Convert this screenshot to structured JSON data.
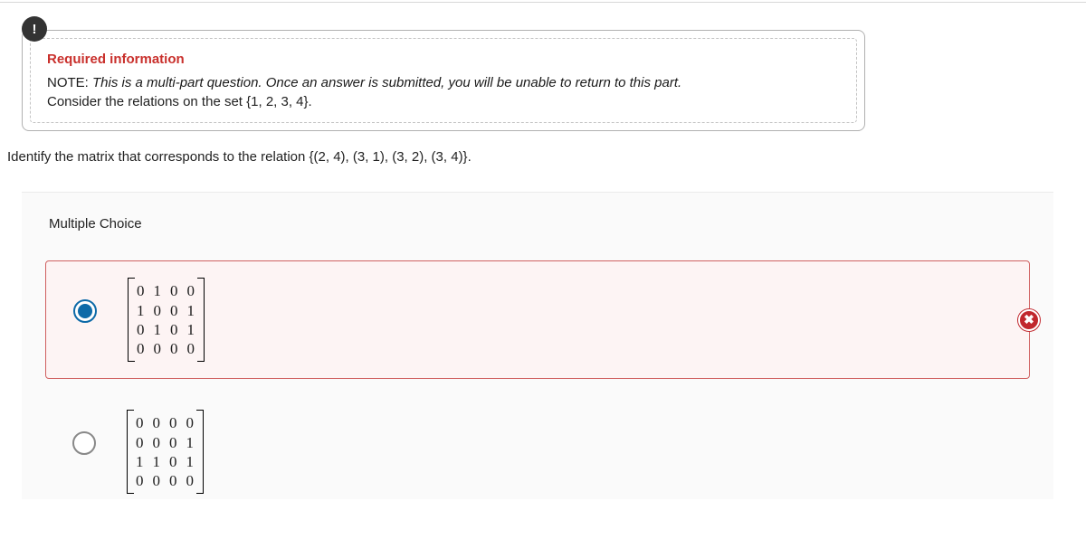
{
  "info": {
    "title": "Required information",
    "note_prefix": "NOTE: ",
    "note_italic": "This is a multi-part question. Once an answer is submitted, you will be unable to return to this part.",
    "consider": "Consider the relations on the set {1, 2, 3, 4}."
  },
  "question": "Identify the matrix that corresponds to the relation {(2, 4), (3, 1), (3, 2), (3, 4)}.",
  "mc_label": "Multiple Choice",
  "choices": [
    {
      "selected": true,
      "incorrect": true,
      "rows": [
        "0  1  0  0",
        "1  0  0  1",
        "0  1  0  1",
        "0  0  0  0"
      ]
    },
    {
      "selected": false,
      "incorrect": false,
      "rows": [
        "0  0  0  0",
        "0  0  0  1",
        "1  1  0  1",
        "0  0  0  0"
      ]
    }
  ],
  "icons": {
    "info": "!",
    "wrong": "✖"
  }
}
